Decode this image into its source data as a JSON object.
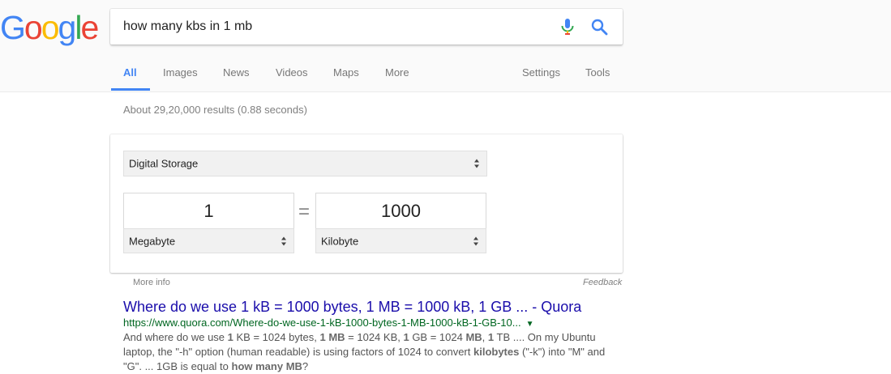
{
  "logo": {
    "letters": [
      "G",
      "o",
      "o",
      "g",
      "l",
      "e"
    ],
    "colors": [
      "#4285f4",
      "#ea4335",
      "#fbbc05",
      "#4285f4",
      "#34a853",
      "#ea4335"
    ]
  },
  "search": {
    "query": "how many kbs in 1 mb",
    "mic_icon": "mic-icon",
    "search_icon": "search-icon"
  },
  "tabs": {
    "all": "All",
    "images": "Images",
    "news": "News",
    "videos": "Videos",
    "maps": "Maps",
    "more": "More",
    "settings": "Settings",
    "tools": "Tools",
    "active_color": "#4285f4"
  },
  "stats": "About 29,20,000 results (0.88 seconds)",
  "converter": {
    "category": "Digital Storage",
    "left_value": "1",
    "left_unit": "Megabyte",
    "equals": "=",
    "right_value": "1000",
    "right_unit": "Kilobyte",
    "more_info": "More info",
    "feedback": "Feedback"
  },
  "result": {
    "title": "Where do we use 1 kB = 1000 bytes, 1 MB = 1000 kB, 1 GB ... - Quora",
    "url": "https://www.quora.com/Where-do-we-use-1-kB-1000-bytes-1-MB-1000-kB-1-GB-10...",
    "url_caret": "▼",
    "snippet": [
      {
        "t": "And where do we use ",
        "b": false
      },
      {
        "t": "1",
        "b": true
      },
      {
        "t": " KB = 1024 bytes, ",
        "b": false
      },
      {
        "t": "1 MB",
        "b": true
      },
      {
        "t": " = 1024 KB, ",
        "b": false
      },
      {
        "t": "1",
        "b": true
      },
      {
        "t": " GB = 1024 ",
        "b": false
      },
      {
        "t": "MB",
        "b": true
      },
      {
        "t": ", ",
        "b": false
      },
      {
        "t": "1",
        "b": true
      },
      {
        "t": " TB .... On my Ubuntu laptop, the \"-h\" option (human readable) is using factors of 1024 to convert ",
        "b": false
      },
      {
        "t": "kilobytes",
        "b": true
      },
      {
        "t": " (\"-k\") into \"M\" and \"G\". ... 1GB is equal to ",
        "b": false
      },
      {
        "t": "how many MB",
        "b": true
      },
      {
        "t": "?",
        "b": false
      }
    ]
  }
}
